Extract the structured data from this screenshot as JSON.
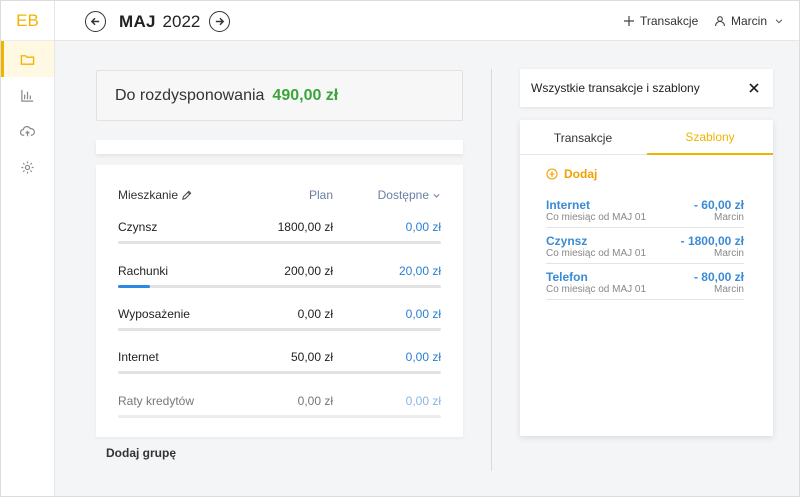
{
  "logo": "EB",
  "header": {
    "month": "MAJ",
    "year": "2022",
    "add_transaction": "Transakcje",
    "user": "Marcin"
  },
  "available": {
    "label": "Do rozdysponowania",
    "amount": "490,00 zł"
  },
  "group": {
    "name": "Mieszkanie",
    "col_plan": "Plan",
    "col_available": "Dostępne",
    "rows": [
      {
        "label": "Czynsz",
        "plan": "1800,00 zł",
        "available": "0,00 zł",
        "progress": 0
      },
      {
        "label": "Rachunki",
        "plan": "200,00 zł",
        "available": "20,00 zł",
        "progress": 0.1
      },
      {
        "label": "Wyposażenie",
        "plan": "0,00 zł",
        "available": "0,00 zł",
        "progress": 0
      },
      {
        "label": "Internet",
        "plan": "50,00 zł",
        "available": "0,00 zł",
        "progress": 0
      },
      {
        "label": "Raty kredytów",
        "plan": "0,00 zł",
        "available": "0,00 zł",
        "progress": 0
      }
    ]
  },
  "add_group": "Dodaj grupę",
  "right_panel": {
    "title": "Wszystkie transakcje i szablony",
    "tabs": [
      "Transakcje",
      "Szablony"
    ],
    "active_tab": "Szablony",
    "add_label": "Dodaj",
    "templates": [
      {
        "name": "Internet",
        "amount": "- 60,00 zł",
        "schedule": "Co miesiąc od MAJ 01",
        "user": "Marcin"
      },
      {
        "name": "Czynsz",
        "amount": "- 1800,00 zł",
        "schedule": "Co miesiąc od MAJ 01",
        "user": "Marcin"
      },
      {
        "name": "Telefon",
        "amount": "- 80,00 zł",
        "schedule": "Co miesiąc od MAJ 01",
        "user": "Marcin"
      }
    ]
  },
  "colors": {
    "accent": "#f0b400",
    "positive": "#3aa63a",
    "link": "#2b7fcf"
  }
}
